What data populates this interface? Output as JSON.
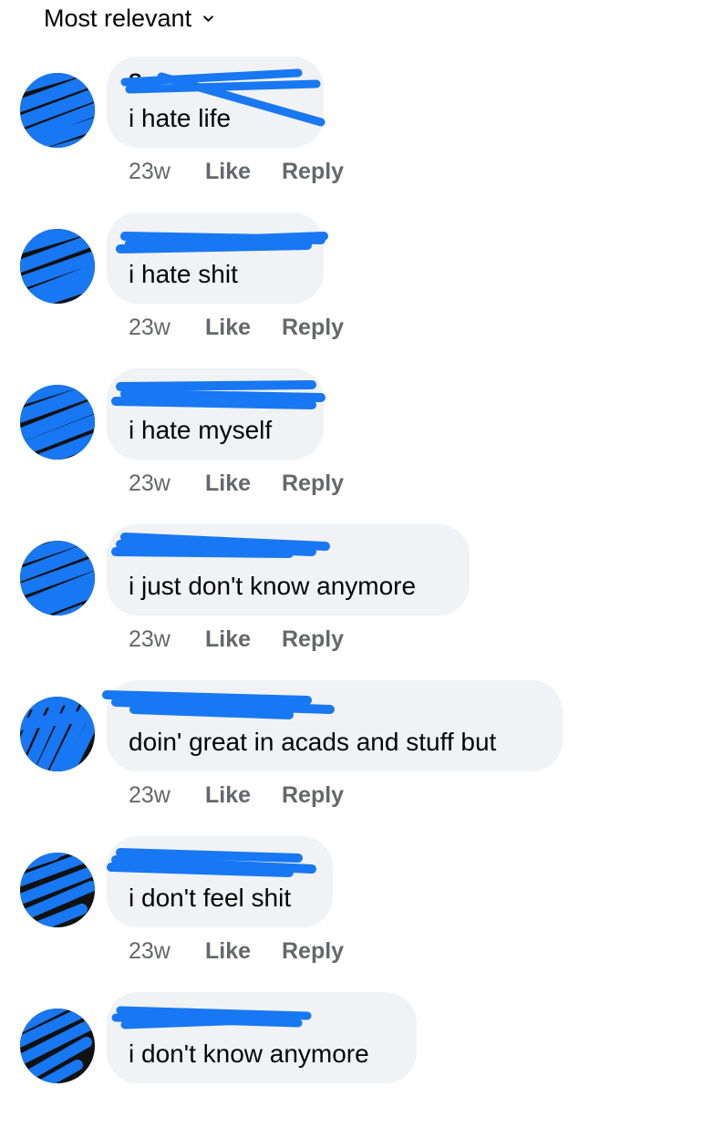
{
  "header": {
    "sort_label": "Most relevant",
    "sort_icon": "chevron-down-icon"
  },
  "colors": {
    "bubble": "#f0f2f5",
    "redaction": "#1877f2",
    "secondary_text": "#65676b"
  },
  "comments": [
    {
      "author": "S",
      "text": "i hate life",
      "time": "23w",
      "like": "Like",
      "reply": "Reply"
    },
    {
      "author": "",
      "text": "i hate shit",
      "time": "23w",
      "like": "Like",
      "reply": "Reply"
    },
    {
      "author": "",
      "text": "i hate myself",
      "time": "23w",
      "like": "Like",
      "reply": "Reply"
    },
    {
      "author": "",
      "text": "i just don't know anymore",
      "time": "23w",
      "like": "Like",
      "reply": "Reply"
    },
    {
      "author": "",
      "text": "doin' great in acads and stuff but",
      "time": "23w",
      "like": "Like",
      "reply": "Reply"
    },
    {
      "author": "",
      "text": "i don't feel shit",
      "time": "23w",
      "like": "Like",
      "reply": "Reply"
    },
    {
      "author": "",
      "text": "i don't know anymore",
      "time": "",
      "like": "",
      "reply": ""
    }
  ]
}
